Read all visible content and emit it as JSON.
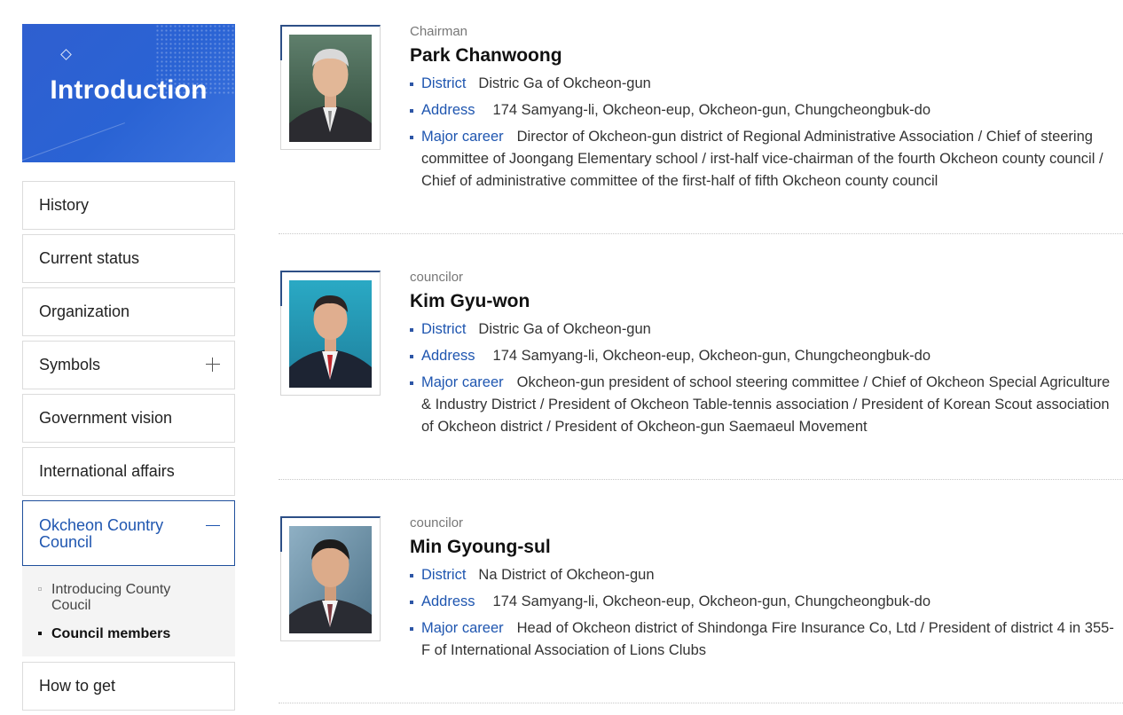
{
  "sidebar": {
    "banner_title": "Introduction",
    "menu": [
      {
        "label": "History"
      },
      {
        "label": "Current status"
      },
      {
        "label": "Organization"
      },
      {
        "label": "Symbols"
      },
      {
        "label": "Government vision"
      },
      {
        "label": "International affairs"
      }
    ],
    "active_menu": "Okcheon Country Council",
    "submenu": [
      {
        "label": "Introducing County Coucil"
      },
      {
        "label": "Council members"
      }
    ],
    "last_menu": "How to get"
  },
  "labels": {
    "district": "District",
    "address": "Address",
    "career": "Major career"
  },
  "members": [
    {
      "role": "Chairman",
      "name": "Park Chanwoong",
      "district": "Distric Ga of Okcheon-gun",
      "address": "174 Samyang-li, Okcheon-eup, Okcheon-gun, Chungcheongbuk-do",
      "career": "Director of Okcheon-gun district of Regional Administrative Association / Chief of steering committee of Joongang Elementary school / irst-half vice-chairman of the fourth Okcheon county council / Chief of administrative committee of the first-half of fifth Okcheon county council"
    },
    {
      "role": "councilor",
      "name": "Kim Gyu-won",
      "district": "Distric Ga of Okcheon-gun",
      "address": "174 Samyang-li, Okcheon-eup, Okcheon-gun, Chungcheongbuk-do",
      "career": "Okcheon-gun president of school steering committee / Chief of Okcheon Special Agriculture & Industry District / President of Okcheon Table-tennis association / President of Korean Scout association of Okcheon district / President of Okcheon-gun Saemaeul Movement"
    },
    {
      "role": "councilor",
      "name": "Min Gyoung-sul",
      "district": "Na District of Okcheon-gun",
      "address": "174 Samyang-li, Okcheon-eup, Okcheon-gun, Chungcheongbuk-do",
      "career": "Head of Okcheon district of Shindonga Fire Insurance Co, Ltd / President of district 4 in 355-F of International Association of Lions Clubs"
    }
  ]
}
